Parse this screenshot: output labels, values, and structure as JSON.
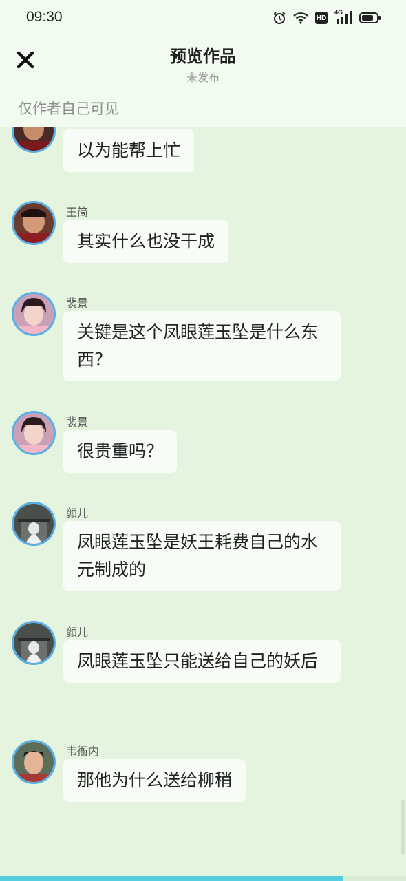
{
  "status": {
    "time": "09:30",
    "icons": [
      "alarm-icon",
      "wifi-icon",
      "hd-icon",
      "signal-4g-icon",
      "battery-icon"
    ],
    "hd_label": "HD",
    "network_label": "4G"
  },
  "header": {
    "close_icon": "close-icon",
    "title": "预览作品",
    "subtitle": "未发布"
  },
  "notice": "仅作者自己可见",
  "messages": [
    {
      "sender": "",
      "text": "以为能帮上忙",
      "avatar": "official"
    },
    {
      "sender": "王简",
      "text": "其实什么也没干成",
      "avatar": "official"
    },
    {
      "sender": "裴景",
      "text": "关键是这个凤眼莲玉坠是什么东西？",
      "avatar": "girl"
    },
    {
      "sender": "裴景",
      "text": "很贵重吗？",
      "avatar": "girl"
    },
    {
      "sender": "颜儿",
      "text": "凤眼莲玉坠是妖王耗费自己的水元制成的",
      "avatar": "ghost"
    },
    {
      "sender": "颜儿",
      "text": "凤眼莲玉坠只能送给自己的妖后",
      "avatar": "ghost"
    },
    {
      "sender": "韦衙内",
      "text": "那他为什么送给柳稍",
      "avatar": "young-man"
    }
  ],
  "progress": {
    "fraction": 0.845
  },
  "colors": {
    "background": "#e4f4de",
    "header": "#f1fbef",
    "bubble": "#f7fdf6",
    "avatar_ring": "#5aaee6",
    "progress": "#55cfe0"
  }
}
